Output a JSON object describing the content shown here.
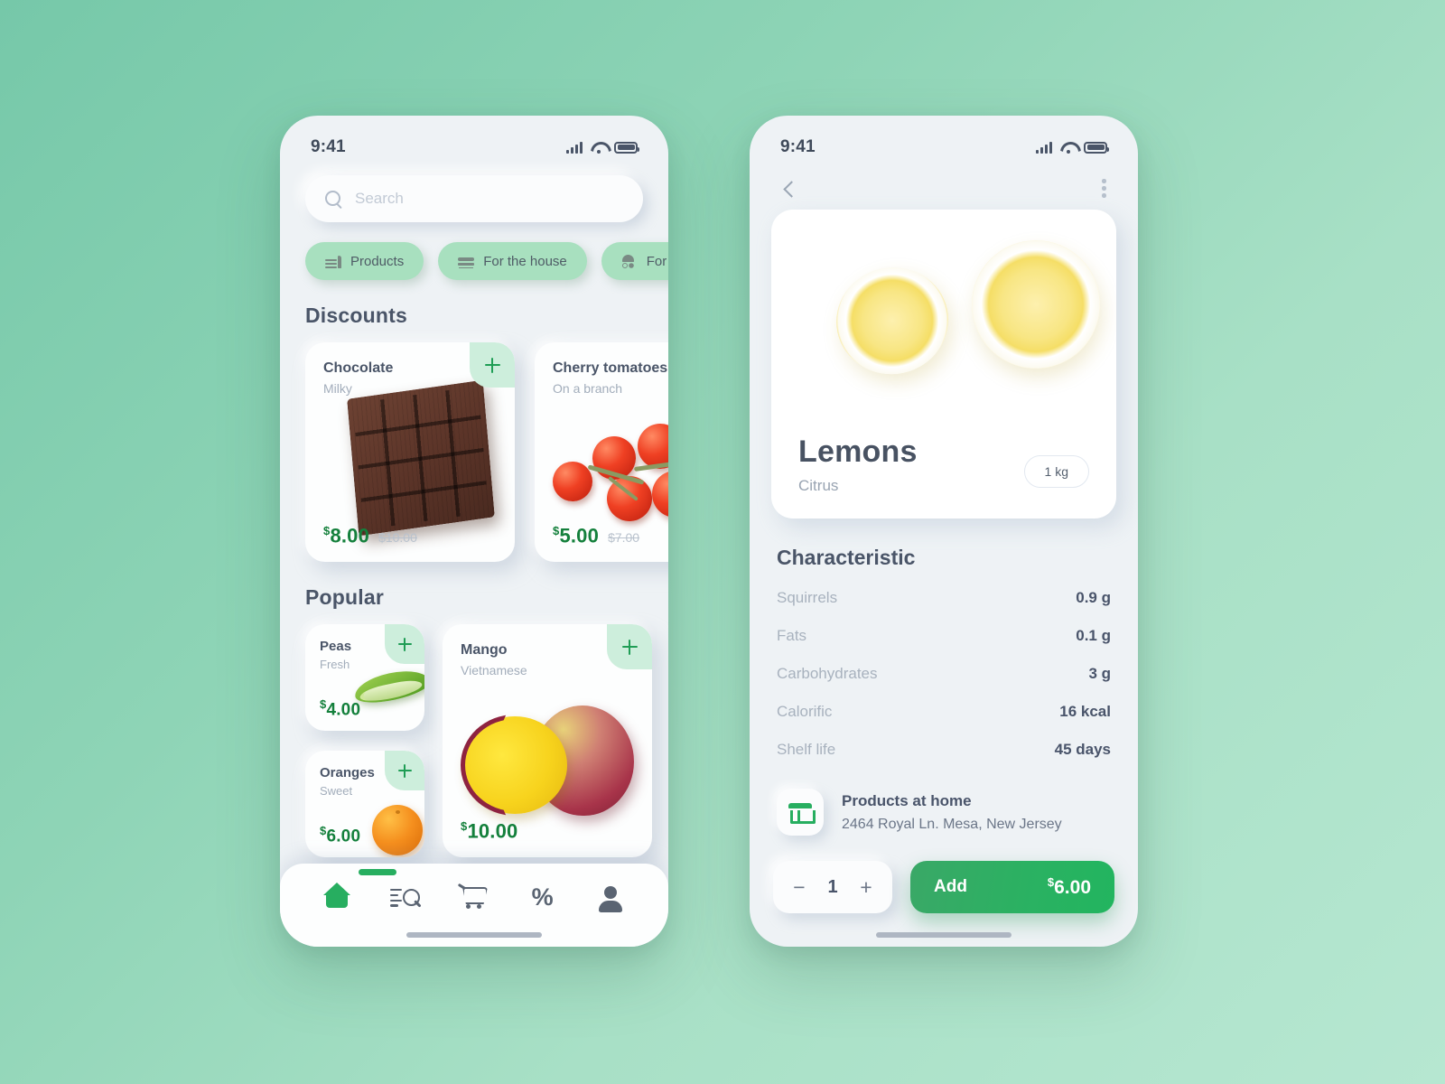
{
  "background": {
    "from": "#76c8a9",
    "to": "#b6e7d1"
  },
  "accent_green": "#27ae60",
  "left_phone": {
    "status": {
      "time": "9:41",
      "signal_icon": "signal-bars-icon",
      "wifi_icon": "wifi-icon",
      "battery_icon": "battery-icon"
    },
    "search": {
      "placeholder": "Search",
      "icon": "search-icon"
    },
    "chips": [
      {
        "label": "Products",
        "icon": "fastfood-icon"
      },
      {
        "label": "For the house",
        "icon": "bed-icon"
      },
      {
        "label": "For children",
        "icon": "stroller-icon"
      }
    ],
    "discounts": {
      "title": "Discounts",
      "items": [
        {
          "name": "Chocolate",
          "sub": "Milky",
          "currency": "$",
          "price": "8.00",
          "old_price": "$10.00",
          "add_icon": "plus-icon"
        },
        {
          "name": "Cherry tomatoes",
          "sub": "On a branch",
          "currency": "$",
          "price": "5.00",
          "old_price": "$7.00",
          "add_icon": "plus-icon"
        }
      ]
    },
    "popular": {
      "title": "Popular",
      "items": [
        {
          "name": "Peas",
          "sub": "Fresh",
          "currency": "$",
          "price": "4.00",
          "add_icon": "plus-icon"
        },
        {
          "name": "Oranges",
          "sub": "Sweet",
          "currency": "$",
          "price": "6.00",
          "add_icon": "plus-icon"
        },
        {
          "name": "Mango",
          "sub": "Vietnamese",
          "currency": "$",
          "price": "10.00",
          "add_icon": "plus-icon"
        }
      ]
    },
    "tabbar": [
      {
        "name": "home",
        "icon": "home-icon",
        "active": true
      },
      {
        "name": "search",
        "icon": "search-list-icon",
        "active": false
      },
      {
        "name": "cart",
        "icon": "cart-icon",
        "active": false
      },
      {
        "name": "discounts",
        "icon": "percent-icon",
        "active": false,
        "glyph": "%"
      },
      {
        "name": "profile",
        "icon": "person-icon",
        "active": false
      }
    ]
  },
  "right_phone": {
    "status": {
      "time": "9:41"
    },
    "nav": {
      "back_icon": "chevron-left-icon",
      "menu_icon": "more-vertical-icon"
    },
    "product": {
      "title": "Lemons",
      "subtitle": "Citrus",
      "weight": "1 kg",
      "image": "lemon-halves-photo"
    },
    "characteristic": {
      "title": "Characteristic",
      "rows": [
        {
          "key": "Squirrels",
          "value": "0.9 g"
        },
        {
          "key": "Fats",
          "value": "0.1 g"
        },
        {
          "key": "Carbohydrates",
          "value": "3 g"
        },
        {
          "key": "Calorific",
          "value": "16 kcal"
        },
        {
          "key": "Shelf life",
          "value": "45 days"
        }
      ]
    },
    "store": {
      "icon": "store-icon",
      "name": "Products at home",
      "address": "2464 Royal Ln. Mesa, New Jersey"
    },
    "actions": {
      "minus": "−",
      "quantity": "1",
      "plus": "+",
      "add_label": "Add",
      "currency": "$",
      "add_price": "6.00"
    }
  }
}
